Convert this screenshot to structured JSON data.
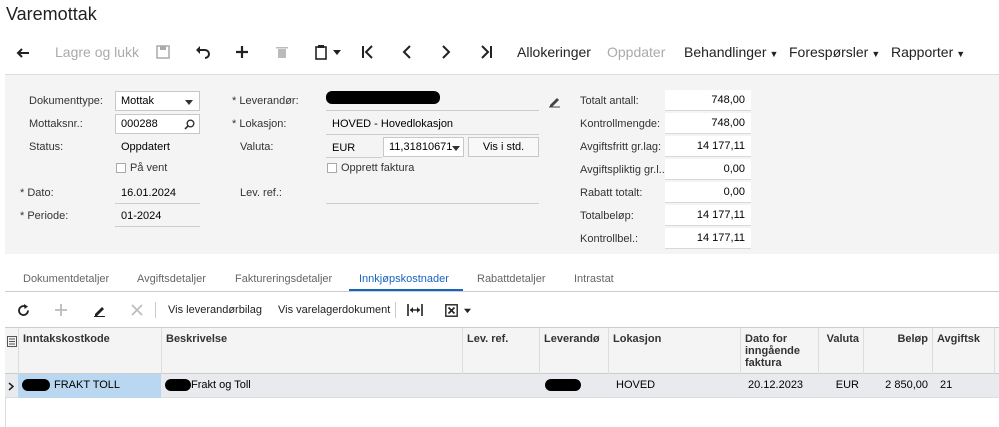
{
  "title": "Varemottak",
  "toolbar": {
    "save_close": "Lagre og lukk",
    "allocations": "Allokeringer",
    "update": "Oppdater",
    "actions": "Behandlinger",
    "inquiries": "Forespørsler",
    "reports": "Rapporter"
  },
  "form": {
    "doc_type_label": "Dokumenttype:",
    "doc_type_value": "Mottak",
    "receipt_no_label": "Mottaksnr.:",
    "receipt_no_value": "000288",
    "status_label": "Status:",
    "status_value": "Oppdatert",
    "on_hold_label": "På vent",
    "date_label": "Dato:",
    "date_value": "16.01.2024",
    "period_label": "Periode:",
    "period_value": "01-2024",
    "supplier_label": "Leverandør:",
    "location_label": "Lokasjon:",
    "location_value": "HOVED - Hovedlokasjon",
    "currency_label": "Valuta:",
    "currency_value": "EUR",
    "rate_value": "11,31810671",
    "show_base_button": "Vis i std.",
    "create_invoice_label": "Opprett faktura",
    "supplier_ref_label": "Lev. ref.:"
  },
  "summary": {
    "total_qty_label": "Totalt antall:",
    "total_qty": "748,00",
    "control_qty_label": "Kontrollmengde:",
    "control_qty": "748,00",
    "tax_exempt_label": "Avgiftsfritt gr.lag:",
    "tax_exempt": "14 177,11",
    "taxable_label": "Avgiftspliktig gr.l...",
    "taxable": "0,00",
    "discount_label": "Rabatt totalt:",
    "discount": "0,00",
    "total_amount_label": "Totalbeløp:",
    "total_amount": "14 177,11",
    "control_amount_label": "Kontrollbel.:",
    "control_amount": "14 177,11"
  },
  "tabs": [
    "Dokumentdetaljer",
    "Avgiftsdetaljer",
    "Faktureringsdetaljer",
    "Innkjøpskostnader",
    "Rabattdetaljer",
    "Intrastat"
  ],
  "grid_toolbar": {
    "show_supplier_doc": "Vis leverandørbilag",
    "show_inventory_doc": "Vis varelagerdokument"
  },
  "grid": {
    "headers": [
      "Inntakskostkode",
      "Beskrivelse",
      "Lev. ref.",
      "Leverandø",
      "Lokasjon",
      "Dato for inngående faktura",
      "Valuta",
      "Beløp",
      "Avgiftsk"
    ],
    "rows": [
      {
        "code": "FRAKT TOLL",
        "description": "Frakt og Toll",
        "supplier_ref": "",
        "location": "HOVED",
        "invoice_date": "20.12.2023",
        "currency": "EUR",
        "amount": "2 850,00",
        "tax_code": "21"
      }
    ]
  },
  "colors": {
    "accent": "#1565c0",
    "form_bg": "#f4f4f4",
    "selected_cell": "#b9d7f0",
    "row_bg": "#e8eaee"
  }
}
